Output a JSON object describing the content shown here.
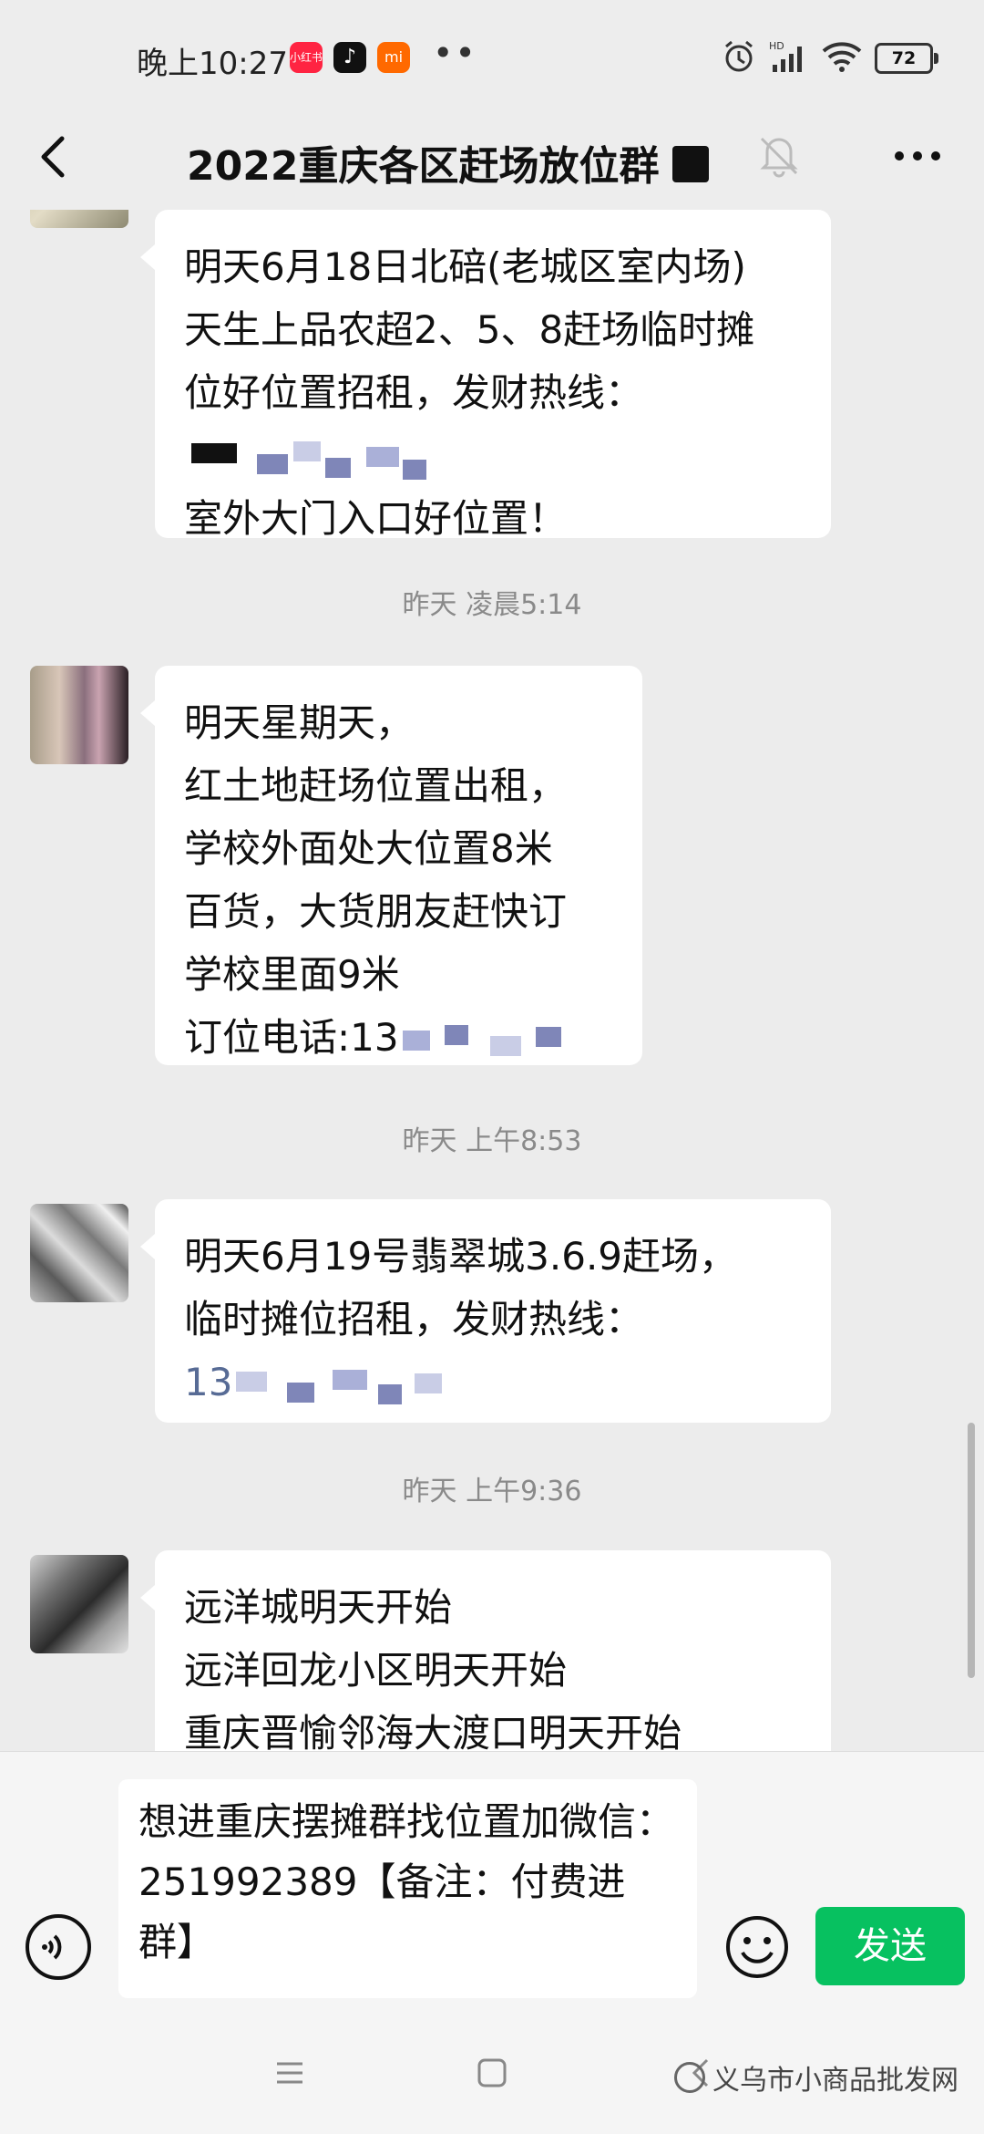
{
  "status_bar": {
    "time": "晚上10:27",
    "apps": [
      {
        "name": "xiaohongshu-icon",
        "color": "#ff2442",
        "label": "小红书"
      },
      {
        "name": "tiktok-icon",
        "color": "#111111",
        "label": "♪"
      },
      {
        "name": "mi-icon",
        "color": "#ff6900",
        "label": "mi"
      }
    ],
    "dots": "••",
    "battery": "72"
  },
  "header": {
    "title": "2022重庆各区赶场放位群"
  },
  "messages": [
    {
      "lines": [
        "明天6月18日北碚(老城区室内场)",
        "天生上品农超2、5、8赶场临时摊",
        "位好位置招租，发财热线："
      ],
      "redacted_line": true,
      "after_lines": [
        "室外大门入口好位置！"
      ]
    },
    {
      "timestamp": "昨天 凌晨5:14",
      "lines": [
        "明天星期天，",
        "红土地赶场位置出租，",
        "学校外面处大位置8米",
        "百货，大货朋友赶快订",
        "学校里面9米"
      ],
      "last_line_prefix": "订位电话:13"
    },
    {
      "timestamp": "昨天 上午8:53",
      "lines": [
        "明天6月19号翡翠城3.6.9赶场，",
        "临时摊位招租，发财热线："
      ],
      "last_line_prefix": "13"
    },
    {
      "timestamp": "昨天 上午9:36",
      "lines": [
        "远洋城明天开始",
        "远洋回龙小区明天开始",
        "重庆晋愉邻海大渡口明天开始"
      ]
    }
  ],
  "input": {
    "text": "想进重庆摆摊群找位置加微信：251992389【备注：付费进群】",
    "send_label": "发送"
  },
  "watermark": "义乌市小商品批发网"
}
